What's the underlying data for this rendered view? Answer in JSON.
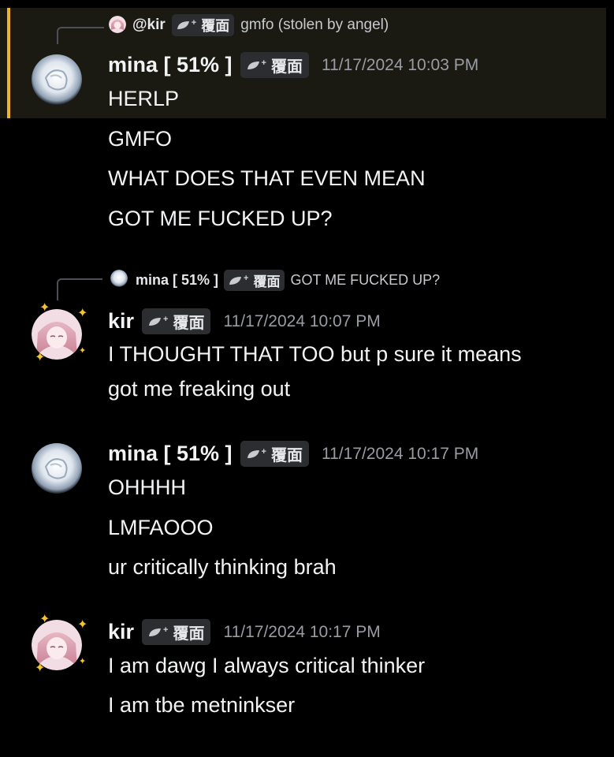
{
  "colors": {
    "background": "#000000",
    "highlight_bg": "#1b1a12",
    "highlight_bar": "#f0b232",
    "timestamp": "#9a9ca3",
    "tag_bg": "#2b2d31"
  },
  "messages": [
    {
      "reply": {
        "name": "@kir",
        "tag": "覆面",
        "text": "gmfo (stolen by angel)"
      },
      "author": "mina [ 51% ]",
      "tag": "覆面",
      "timestamp": "11/17/2024 10:03 PM",
      "lines": [
        "HERLP",
        "GMFO",
        "WHAT DOES THAT EVEN MEAN",
        "GOT ME FUCKED UP?"
      ]
    },
    {
      "reply": {
        "name": "mina [ 51% ]",
        "tag": "覆面",
        "text": "GOT ME FUCKED UP?"
      },
      "author": "kir",
      "tag": "覆面",
      "timestamp": "11/17/2024 10:07 PM",
      "lines": [
        "I THOUGHT THAT TOO but p sure it means",
        "got me freaking out"
      ]
    },
    {
      "author": "mina [ 51% ]",
      "tag": "覆面",
      "timestamp": "11/17/2024 10:17 PM",
      "lines": [
        "OHHHH",
        "LMFAOOO",
        "ur critically thinking brah"
      ]
    },
    {
      "author": "kir",
      "tag": "覆面",
      "timestamp": "11/17/2024 10:17 PM",
      "lines": [
        "I am dawg I always critical thinker",
        "I am tbe metninkser"
      ]
    }
  ]
}
